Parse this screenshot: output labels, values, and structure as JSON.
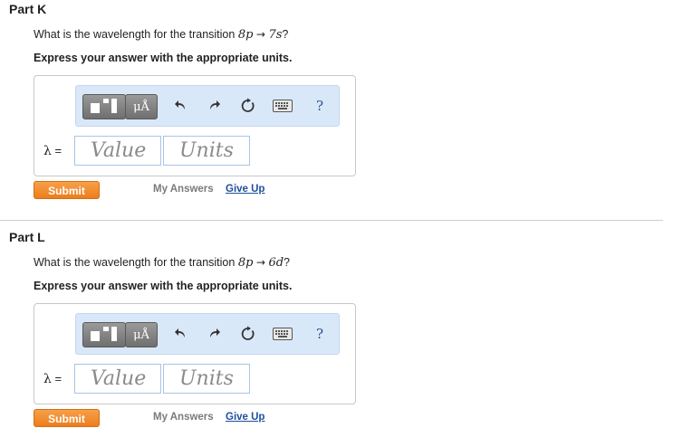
{
  "parts": [
    {
      "title": "Part K",
      "question_prefix": "What is the wavelength for the transition ",
      "from_state": "8p",
      "arrow": "→",
      "to_state": "7s",
      "question_suffix": "?",
      "instruction": "Express your answer with the appropriate units.",
      "toolbar": {
        "units_label": "μÅ",
        "help_label": "?"
      },
      "answer": {
        "variable": "λ",
        "equals": "=",
        "value_placeholder": "Value",
        "units_placeholder": "Units"
      },
      "submit_label": "Submit",
      "my_answers_label": "My Answers",
      "give_up_label": "Give Up"
    },
    {
      "title": "Part L",
      "question_prefix": "What is the wavelength for the transition ",
      "from_state": "8p",
      "arrow": "→",
      "to_state": "6d",
      "question_suffix": "?",
      "instruction": "Express your answer with the appropriate units.",
      "toolbar": {
        "units_label": "μÅ",
        "help_label": "?"
      },
      "answer": {
        "variable": "λ",
        "equals": "=",
        "value_placeholder": "Value",
        "units_placeholder": "Units"
      },
      "submit_label": "Submit",
      "my_answers_label": "My Answers",
      "give_up_label": "Give Up"
    }
  ],
  "colors": {
    "submit": "#ec7d1c",
    "link": "#1f4f9e",
    "toolbar_bg": "#d9e8f8"
  },
  "icons": {
    "template": "templates-icon",
    "units": "units-icon",
    "undo": "undo-icon",
    "redo": "redo-icon",
    "reset": "reset-icon",
    "keyboard": "keyboard-icon",
    "help": "help-icon"
  }
}
